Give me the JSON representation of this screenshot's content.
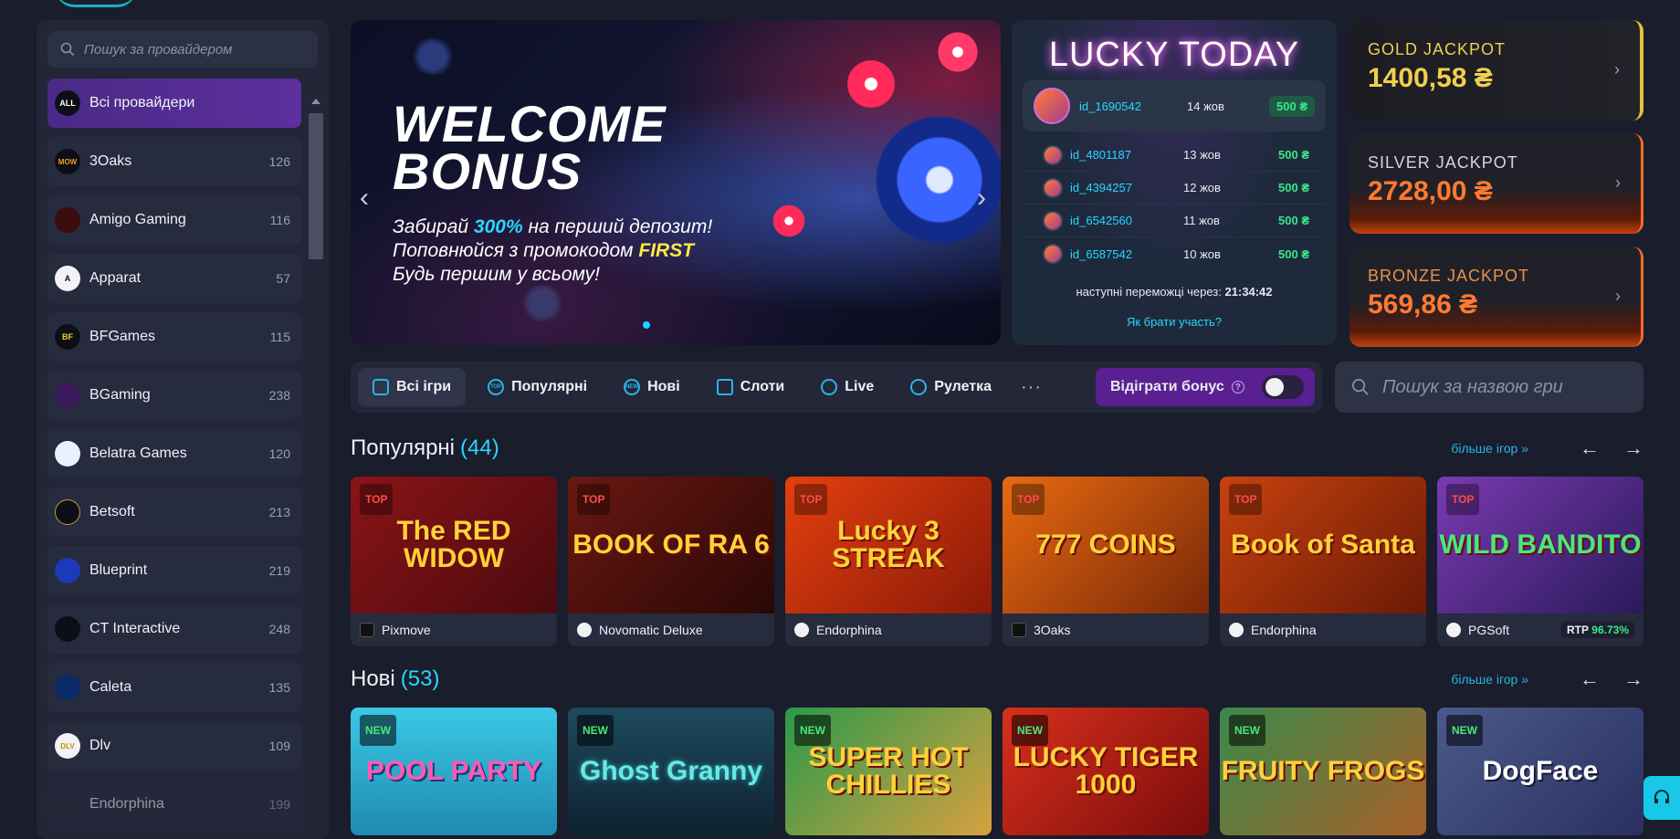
{
  "sidebar": {
    "search_placeholder": "Пошук за провайдером",
    "providers": [
      {
        "logo": "ALL",
        "name": "Всі провайдери",
        "count": "",
        "active": true
      },
      {
        "logo": "MOW",
        "name": "3Oaks",
        "count": "126"
      },
      {
        "logo": "",
        "name": "Amigo Gaming",
        "count": "116"
      },
      {
        "logo": "A",
        "name": "Apparat",
        "count": "57"
      },
      {
        "logo": "BF",
        "name": "BFGames",
        "count": "115"
      },
      {
        "logo": "",
        "name": "BGaming",
        "count": "238"
      },
      {
        "logo": "",
        "name": "Belatra Games",
        "count": "120"
      },
      {
        "logo": "",
        "name": "Betsoft",
        "count": "213"
      },
      {
        "logo": "",
        "name": "Blueprint",
        "count": "219"
      },
      {
        "logo": "",
        "name": "CT Interactive",
        "count": "248"
      },
      {
        "logo": "",
        "name": "Caleta",
        "count": "135"
      },
      {
        "logo": "DLV",
        "name": "Dlv",
        "count": "109"
      },
      {
        "logo": "",
        "name": "Endorphina",
        "count": "199"
      }
    ]
  },
  "banner": {
    "title_line1": "WELCOME",
    "title_line2": "BONUS",
    "line1_pre": "Забирай ",
    "line1_hl": "300%",
    "line1_post": " на перший депозит!",
    "line2_pre": "Поповнюйся з промокодом ",
    "line2_hl": "FIRST",
    "line3": "Будь першим у всьому!",
    "prev": "‹",
    "next": "›"
  },
  "lucky": {
    "title": "LUCKY TODAY",
    "winners": [
      {
        "id": "id_1690542",
        "date": "14 жов",
        "amount": "500 ₴"
      },
      {
        "id": "id_4801187",
        "date": "13 жов",
        "amount": "500 ₴"
      },
      {
        "id": "id_4394257",
        "date": "12 жов",
        "amount": "500 ₴"
      },
      {
        "id": "id_6542560",
        "date": "11 жов",
        "amount": "500 ₴"
      },
      {
        "id": "id_6587542",
        "date": "10 жов",
        "amount": "500 ₴"
      }
    ],
    "next_label": "наступні переможці через: ",
    "next_time": "21:34:42",
    "how_to": "Як брати участь?"
  },
  "jackpots": [
    {
      "label": "GOLD JACKPOT",
      "value": "1400,58 ₴"
    },
    {
      "label": "SILVER JACKPOT",
      "value": "2728,00 ₴"
    },
    {
      "label": "BRONZE JACKPOT",
      "value": "569,86 ₴"
    }
  ],
  "tabs": {
    "items": [
      {
        "label": "Всі ігри",
        "icon": "gamepad-icon"
      },
      {
        "label": "Популярні",
        "icon": "top-icon"
      },
      {
        "label": "Нові",
        "icon": "new-icon"
      },
      {
        "label": "Слоти",
        "icon": "slots-icon"
      },
      {
        "label": "Live",
        "icon": "live-icon"
      },
      {
        "label": "Рулетка",
        "icon": "roulette-icon"
      }
    ],
    "more": "···",
    "bonus_label": "Відіграти бонус",
    "bonus_help": "?"
  },
  "game_search": {
    "placeholder": "Пошук за назвою гри"
  },
  "popular": {
    "title": "Популярні",
    "count": "(44)",
    "more": "більше ігор »",
    "prev": "←",
    "next": "→",
    "games": [
      {
        "title": "The RED WIDOW",
        "tag": "TOP",
        "provider": "Pixmove",
        "bg": "#7a0f14"
      },
      {
        "title": "BOOK OF RA 6",
        "tag": "TOP",
        "provider": "Novomatic Deluxe",
        "bg": "#5a1410"
      },
      {
        "title": "Lucky 3 STREAK",
        "tag": "TOP",
        "provider": "Endorphina",
        "bg": "#c2300e"
      },
      {
        "title": "777 COINS",
        "tag": "TOP",
        "provider": "3Oaks",
        "bg": "#b8460c"
      },
      {
        "title": "Book of Santa",
        "tag": "TOP",
        "provider": "Endorphina",
        "bg": "#a2330c"
      },
      {
        "title": "WILD BANDITO",
        "tag": "TOP",
        "provider": "PGSoft",
        "bg": "#5a2a8a",
        "rtp_label": "RTP",
        "rtp": "96.73%"
      }
    ]
  },
  "new": {
    "title": "Нові",
    "count": "(53)",
    "more": "більше ігор »",
    "prev": "←",
    "next": "→",
    "games": [
      {
        "title": "POOL PARTY",
        "tag": "NEW",
        "bg": "#28b6d6"
      },
      {
        "title": "Ghost Granny",
        "tag": "NEW",
        "bg": "#163a4e"
      },
      {
        "title": "SUPER HOT CHILLIES",
        "tag": "NEW",
        "bg": "#1c8a3a"
      },
      {
        "title": "LUCKY TIGER 1000",
        "tag": "NEW",
        "bg": "#b21c1c"
      },
      {
        "title": "FRUITY FROGS",
        "tag": "NEW",
        "bg": "#2e6a3a"
      },
      {
        "title": "DogFace",
        "tag": "NEW",
        "bg": "#3a4a7a"
      }
    ]
  }
}
